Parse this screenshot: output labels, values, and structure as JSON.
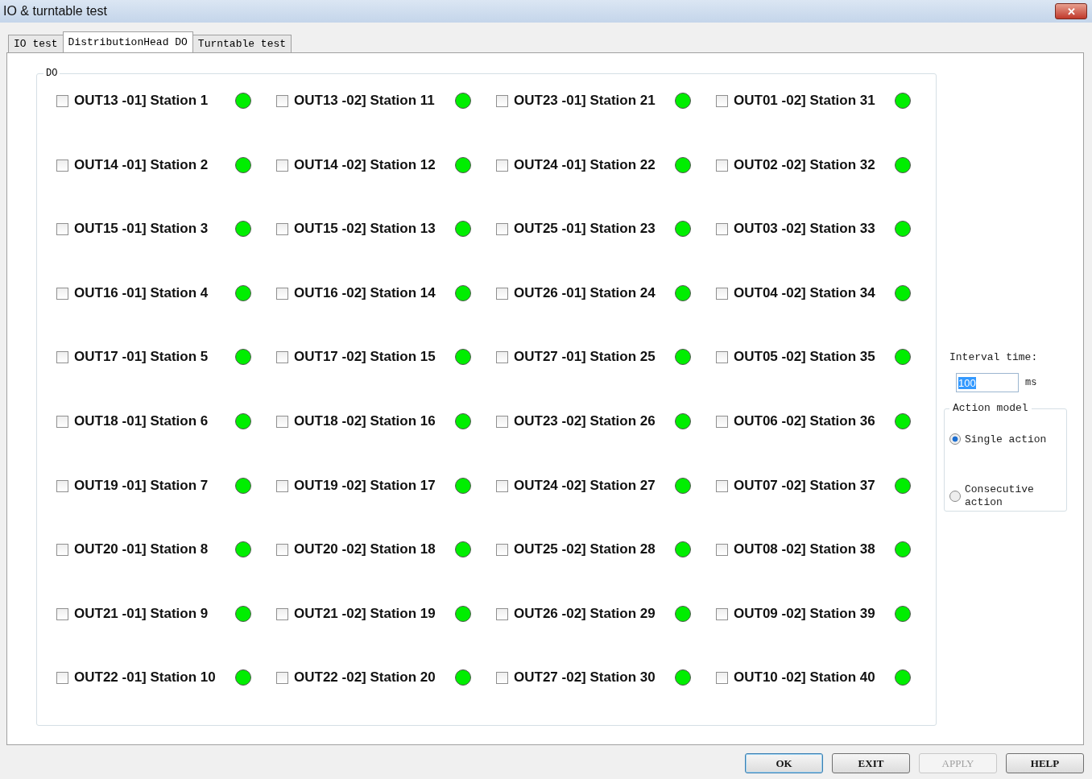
{
  "window": {
    "title": "IO & turntable test",
    "close": "✕"
  },
  "tabs": [
    {
      "label": "IO test",
      "selected": false
    },
    {
      "label": "DistributionHead DO",
      "selected": true
    },
    {
      "label": "Turntable test",
      "selected": false
    }
  ],
  "do_group": {
    "title": "DO",
    "columns": [
      [
        {
          "label": "OUT13 -01] Station 1",
          "checked": false,
          "on": true
        },
        {
          "label": "OUT14 -01] Station 2",
          "checked": false,
          "on": true
        },
        {
          "label": "OUT15 -01] Station 3",
          "checked": false,
          "on": true
        },
        {
          "label": "OUT16 -01] Station 4",
          "checked": false,
          "on": true
        },
        {
          "label": "OUT17 -01] Station 5",
          "checked": false,
          "on": true
        },
        {
          "label": "OUT18 -01] Station 6",
          "checked": false,
          "on": true
        },
        {
          "label": "OUT19 -01] Station 7",
          "checked": false,
          "on": true
        },
        {
          "label": "OUT20 -01] Station 8",
          "checked": false,
          "on": true
        },
        {
          "label": "OUT21 -01] Station 9",
          "checked": false,
          "on": true
        },
        {
          "label": "OUT22 -01] Station 10",
          "checked": false,
          "on": true
        }
      ],
      [
        {
          "label": "OUT13 -02] Station 11",
          "checked": false,
          "on": true
        },
        {
          "label": "OUT14 -02] Station 12",
          "checked": false,
          "on": true
        },
        {
          "label": "OUT15 -02] Station 13",
          "checked": false,
          "on": true
        },
        {
          "label": "OUT16 -02] Station 14",
          "checked": false,
          "on": true
        },
        {
          "label": "OUT17 -02] Station 15",
          "checked": false,
          "on": true
        },
        {
          "label": "OUT18 -02] Station 16",
          "checked": false,
          "on": true
        },
        {
          "label": "OUT19 -02] Station 17",
          "checked": false,
          "on": true
        },
        {
          "label": "OUT20 -02] Station 18",
          "checked": false,
          "on": true
        },
        {
          "label": "OUT21 -02] Station 19",
          "checked": false,
          "on": true
        },
        {
          "label": "OUT22 -02] Station 20",
          "checked": false,
          "on": true
        }
      ],
      [
        {
          "label": "OUT23 -01] Station 21",
          "checked": false,
          "on": true
        },
        {
          "label": "OUT24 -01] Station 22",
          "checked": false,
          "on": true
        },
        {
          "label": "OUT25 -01] Station 23",
          "checked": false,
          "on": true
        },
        {
          "label": "OUT26 -01] Station 24",
          "checked": false,
          "on": true
        },
        {
          "label": "OUT27 -01] Station 25",
          "checked": false,
          "on": true
        },
        {
          "label": "OUT23 -02] Station 26",
          "checked": false,
          "on": true
        },
        {
          "label": "OUT24 -02] Station 27",
          "checked": false,
          "on": true
        },
        {
          "label": "OUT25 -02] Station 28",
          "checked": false,
          "on": true
        },
        {
          "label": "OUT26 -02] Station 29",
          "checked": false,
          "on": true
        },
        {
          "label": "OUT27 -02] Station 30",
          "checked": false,
          "on": true
        }
      ],
      [
        {
          "label": "OUT01 -02] Station 31",
          "checked": false,
          "on": true
        },
        {
          "label": "OUT02 -02] Station 32",
          "checked": false,
          "on": true
        },
        {
          "label": "OUT03 -02] Station 33",
          "checked": false,
          "on": true
        },
        {
          "label": "OUT04 -02] Station 34",
          "checked": false,
          "on": true
        },
        {
          "label": "OUT05 -02] Station 35",
          "checked": false,
          "on": true
        },
        {
          "label": "OUT06 -02] Station 36",
          "checked": false,
          "on": true
        },
        {
          "label": "OUT07 -02] Station 37",
          "checked": false,
          "on": true
        },
        {
          "label": "OUT08 -02] Station 38",
          "checked": false,
          "on": true
        },
        {
          "label": "OUT09 -02] Station 39",
          "checked": false,
          "on": true
        },
        {
          "label": "OUT10 -02] Station 40",
          "checked": false,
          "on": true
        }
      ]
    ]
  },
  "interval": {
    "label": "Interval time:",
    "value": "100",
    "unit": "ms"
  },
  "action_model": {
    "title": "Action model",
    "options": [
      {
        "label": "Single action",
        "selected": true
      },
      {
        "label": "Consecutive action",
        "selected": false
      }
    ]
  },
  "buttons": [
    {
      "label": "OK",
      "disabled": false,
      "default": true
    },
    {
      "label": "EXIT",
      "disabled": false,
      "default": false
    },
    {
      "label": "APPLY",
      "disabled": true,
      "default": false
    },
    {
      "label": "HELP",
      "disabled": false,
      "default": false
    }
  ]
}
